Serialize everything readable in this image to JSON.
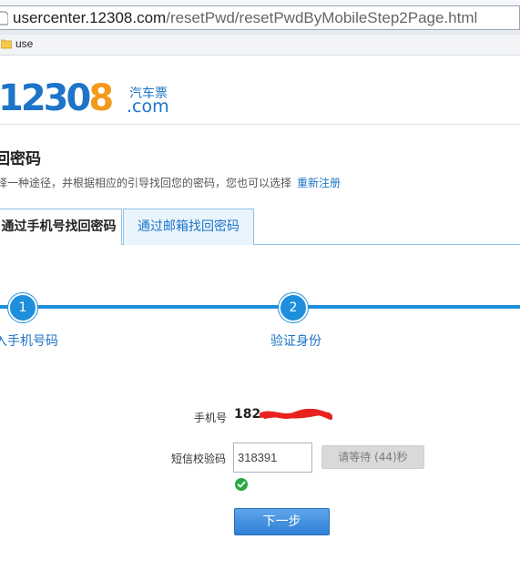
{
  "browser": {
    "url_host": "usercenter.12308.com",
    "url_path": "/resetPwd/resetPwdByMobileStep2Page.html",
    "favorites_folder": "use"
  },
  "logo": {
    "digits_blue": "23",
    "digit_zero": "0",
    "digit_orange": "8",
    "leading_digit": "1",
    "cn_text": "汽车票",
    "com_text": ".com"
  },
  "page": {
    "title": "回密码",
    "description": "择一种途径，并根据相应的引导找回您的密码，您也可以选择",
    "register_link": "重新注册"
  },
  "tabs": [
    {
      "label": "通过手机号找回密码",
      "active": true
    },
    {
      "label": "通过邮箱找回密码",
      "active": false
    }
  ],
  "steps": [
    {
      "number": "1",
      "label": "入手机号码"
    },
    {
      "number": "2",
      "label": "验证身份"
    }
  ],
  "form": {
    "phone_label": "手机号",
    "phone_value": "182",
    "code_label": "短信校验码",
    "code_value": "318391",
    "wait_button": "请等待 (44)秒",
    "next_button": "下一步"
  },
  "colors": {
    "brand_blue": "#1d74c8",
    "brand_orange": "#f39a1e",
    "step_blue": "#1e8fdc",
    "success_green": "#27a844"
  }
}
